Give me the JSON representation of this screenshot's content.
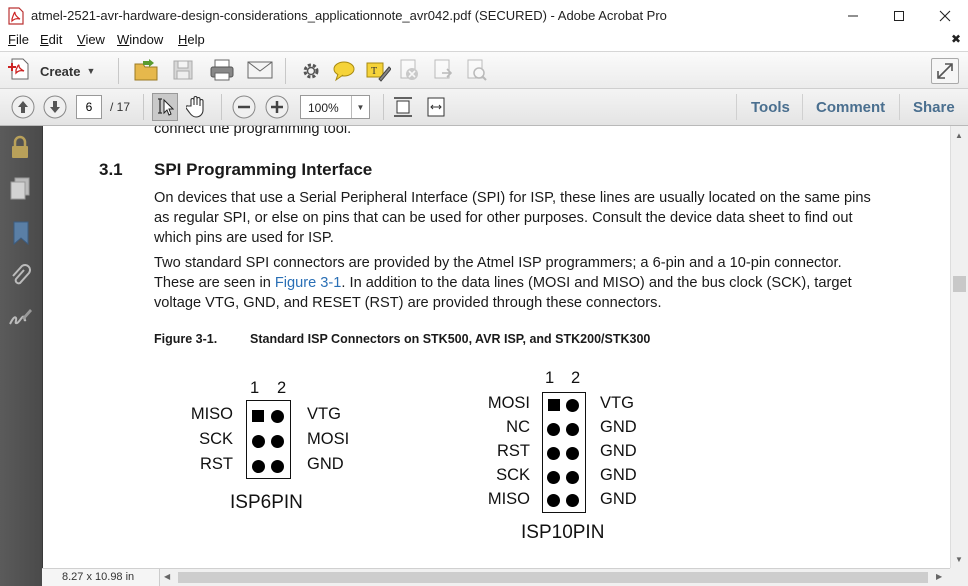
{
  "window": {
    "title": "atmel-2521-avr-hardware-design-considerations_applicationnote_avr042.pdf (SECURED) - Adobe Acrobat Pro"
  },
  "menu": {
    "items": [
      {
        "label": "File",
        "key": "F",
        "rest": "ile"
      },
      {
        "label": "Edit",
        "key": "E",
        "rest": "dit"
      },
      {
        "label": "View",
        "key": "V",
        "rest": "iew"
      },
      {
        "label": "Window",
        "key": "W",
        "rest": "indow"
      },
      {
        "label": "Help",
        "key": "H",
        "rest": "elp"
      }
    ],
    "close_glyph": "✖"
  },
  "toolbar": {
    "create_label": "Create",
    "page_current": "6",
    "page_total": "/ 17",
    "zoom": "100%",
    "tools_label": "Tools",
    "comment_label": "Comment",
    "share_label": "Share"
  },
  "document": {
    "top_fragment": "connect the programming tool.",
    "section_number": "3.1",
    "section_title": "SPI Programming Interface",
    "para1": [
      "On devices that use a Serial Peripheral Interface (SPI) for ISP, these lines are usually located on the same pins",
      "as regular SPI, or else on pins that can be used for other purposes. Consult the device data sheet to find out",
      "which pins are used for ISP."
    ],
    "para2_line1": "Two standard SPI connectors are provided by the Atmel ISP programmers; a 6-pin and a 10-pin connector.",
    "para2_line2_pre": "These are seen in ",
    "para2_line2_link": "Figure 3-1",
    "para2_line2_post": ". In addition to the data lines (MOSI and MISO) and the bus clock (SCK), target",
    "para2_line3": "voltage VTG, GND, and RESET (RST) are provided through these connectors.",
    "figure_label": "Figure 3-1.",
    "figure_caption": "Standard ISP Connectors on STK500, AVR ISP, and STK200/STK300",
    "isp6": {
      "col_numbers": [
        "1",
        "2"
      ],
      "left_pins": [
        "MISO",
        "SCK",
        "RST"
      ],
      "right_pins": [
        "VTG",
        "MOSI",
        "GND"
      ],
      "name": "ISP6PIN"
    },
    "isp10": {
      "col_numbers": [
        "1",
        "2"
      ],
      "left_pins": [
        "MOSI",
        "NC",
        "RST",
        "SCK",
        "MISO"
      ],
      "right_pins": [
        "VTG",
        "GND",
        "GND",
        "GND",
        "GND"
      ],
      "name": "ISP10PIN"
    }
  },
  "statusbar": {
    "page_size": "8.27 x 10.98 in"
  }
}
